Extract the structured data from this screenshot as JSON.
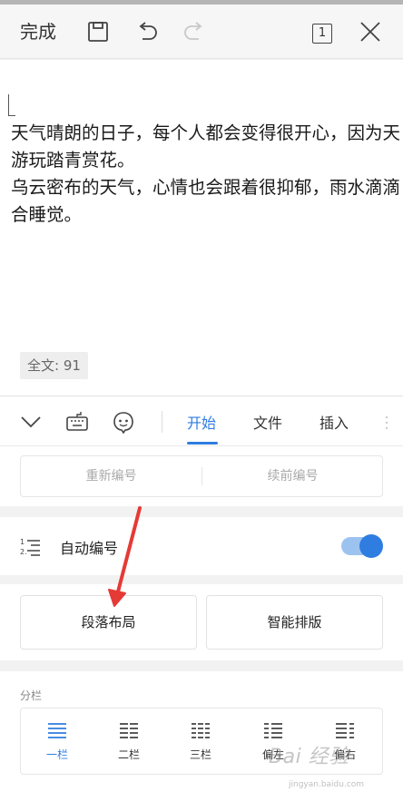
{
  "toolbar": {
    "done_label": "完成",
    "icons": [
      "save-icon",
      "undo-icon",
      "redo-icon",
      "page-count-icon",
      "close-icon"
    ],
    "page_number": "1"
  },
  "document": {
    "lines": [
      "天气晴朗的日子，每个人都会变得很开心，因为天",
      "游玩踏青赏花。",
      "乌云密布的天气，心情也会跟着很抑郁，雨水滴滴",
      "合睡觉。"
    ],
    "word_count": "全文: 91"
  },
  "tabbar": {
    "icons": [
      "collapse-icon",
      "keyboard-icon",
      "assistant-icon"
    ],
    "tabs": [
      {
        "label": "开始",
        "active": true
      },
      {
        "label": "文件",
        "active": false
      },
      {
        "label": "插入",
        "active": false
      }
    ],
    "accent_color": "#2f7de1"
  },
  "numbering": {
    "restart_label": "重新编号",
    "continue_label": "续前编号"
  },
  "auto_numbering": {
    "label": "自动编号",
    "enabled": true
  },
  "layout": {
    "paragraph_label": "段落布局",
    "smart_label": "智能排版"
  },
  "columns": {
    "title": "分栏",
    "options": [
      {
        "label": "一栏",
        "active": true
      },
      {
        "label": "二栏",
        "active": false
      },
      {
        "label": "三栏",
        "active": false
      },
      {
        "label": "偏左",
        "active": false
      },
      {
        "label": "偏右",
        "active": false
      }
    ]
  },
  "watermark": {
    "text": "Bai 经验",
    "sub": "jingyan.baidu.com"
  }
}
